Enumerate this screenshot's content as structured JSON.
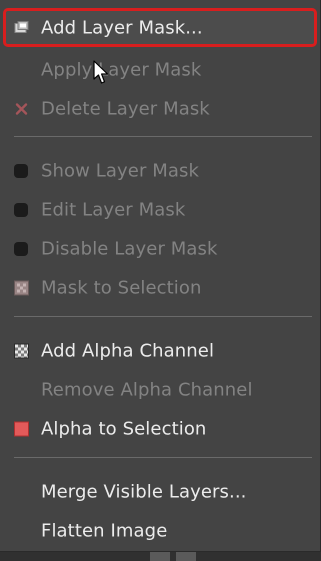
{
  "menu": {
    "items": [
      {
        "label": "Add Layer Mask...",
        "icon": "layer-mask-icon"
      },
      {
        "label": "Apply Layer Mask"
      },
      {
        "label": "Delete Layer Mask",
        "icon": "delete-x-icon"
      },
      {
        "label": "Show Layer Mask",
        "icon": "dot-icon"
      },
      {
        "label": "Edit Layer Mask",
        "icon": "dot-icon"
      },
      {
        "label": "Disable Layer Mask",
        "icon": "dot-icon"
      },
      {
        "label": "Mask to Selection",
        "icon": "mask-selection-icon"
      },
      {
        "label": "Add Alpha Channel",
        "icon": "checkerboard-icon"
      },
      {
        "label": "Remove Alpha Channel"
      },
      {
        "label": "Alpha to Selection",
        "icon": "alpha-selection-icon"
      },
      {
        "label": "Merge Visible Layers..."
      },
      {
        "label": "Flatten Image"
      }
    ]
  },
  "colors": {
    "menu_bg": "#444444",
    "highlight_border": "#d81e1e",
    "enabled_text": "#ececec",
    "disabled_text": "#838383"
  }
}
